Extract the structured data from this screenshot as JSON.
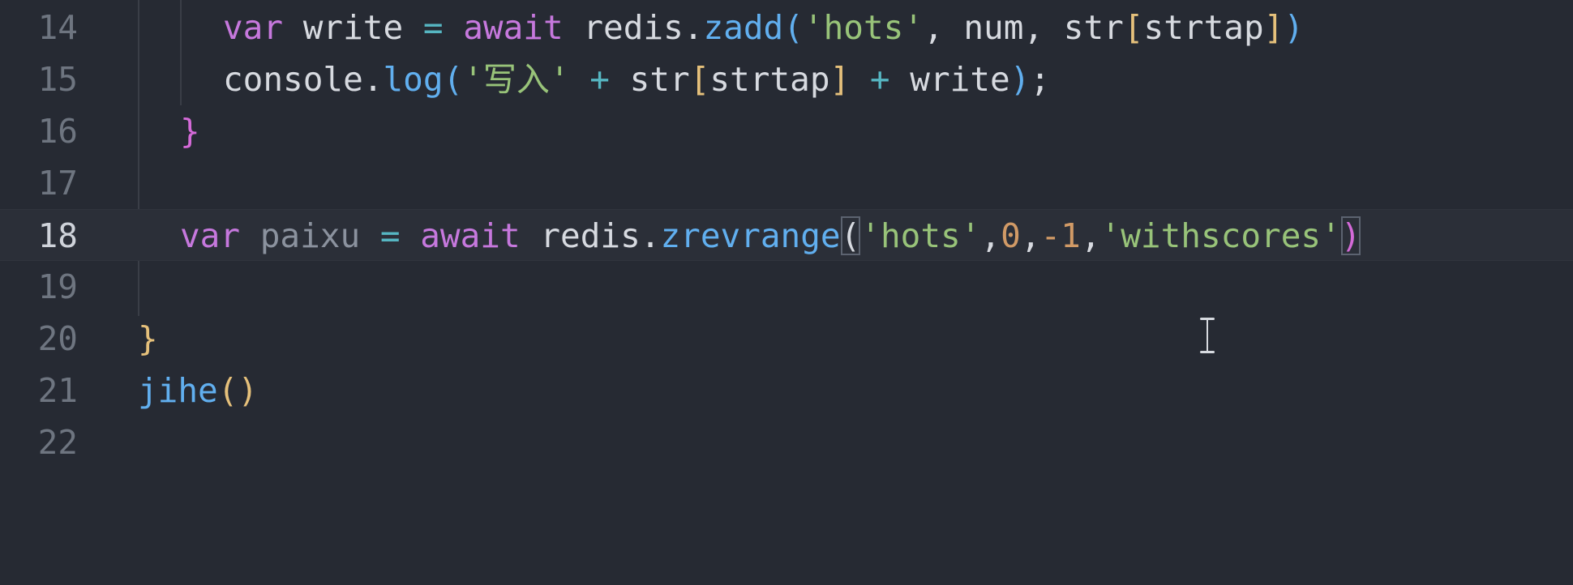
{
  "editor": {
    "current_line": "18",
    "lines": [
      {
        "number": "14"
      },
      {
        "number": "15"
      },
      {
        "number": "16"
      },
      {
        "number": "17"
      },
      {
        "number": "18"
      },
      {
        "number": "19"
      },
      {
        "number": "20"
      },
      {
        "number": "21"
      },
      {
        "number": "22"
      }
    ],
    "code": {
      "l14": {
        "kw_var": "var",
        "name": " write ",
        "eq": "=",
        "kw_await": " await",
        "obj": " redis.",
        "fn": "zadd",
        "open": "(",
        "str": "'hots'",
        "args": ", num, str",
        "br_open": "[",
        "idx": "strtap",
        "br_close": "]",
        "close": ")"
      },
      "l15": {
        "obj": "console.",
        "fn": "log",
        "open": "(",
        "str": "'写入'",
        "plus1": " + ",
        "mid": "str",
        "br_open": "[",
        "idx": "strtap",
        "br_close": "]",
        "plus2": " + ",
        "tail": "write",
        "close": ")",
        "semi": ";"
      },
      "l16": {
        "brace": "}"
      },
      "l18": {
        "kw_var": "var",
        "name": " paixu ",
        "eq": "=",
        "kw_await": " await",
        "obj": " redis.",
        "fn": "zrevrange",
        "open": "(",
        "str1": "'hots'",
        "comma1": ",",
        "n1": "0",
        "comma2": ",",
        "n2": "-1",
        "comma3": ",",
        "str2": "'withscores'",
        "close": ")"
      },
      "l20": {
        "brace": "}"
      },
      "l21": {
        "fn": "jihe",
        "parens": "()"
      }
    }
  }
}
